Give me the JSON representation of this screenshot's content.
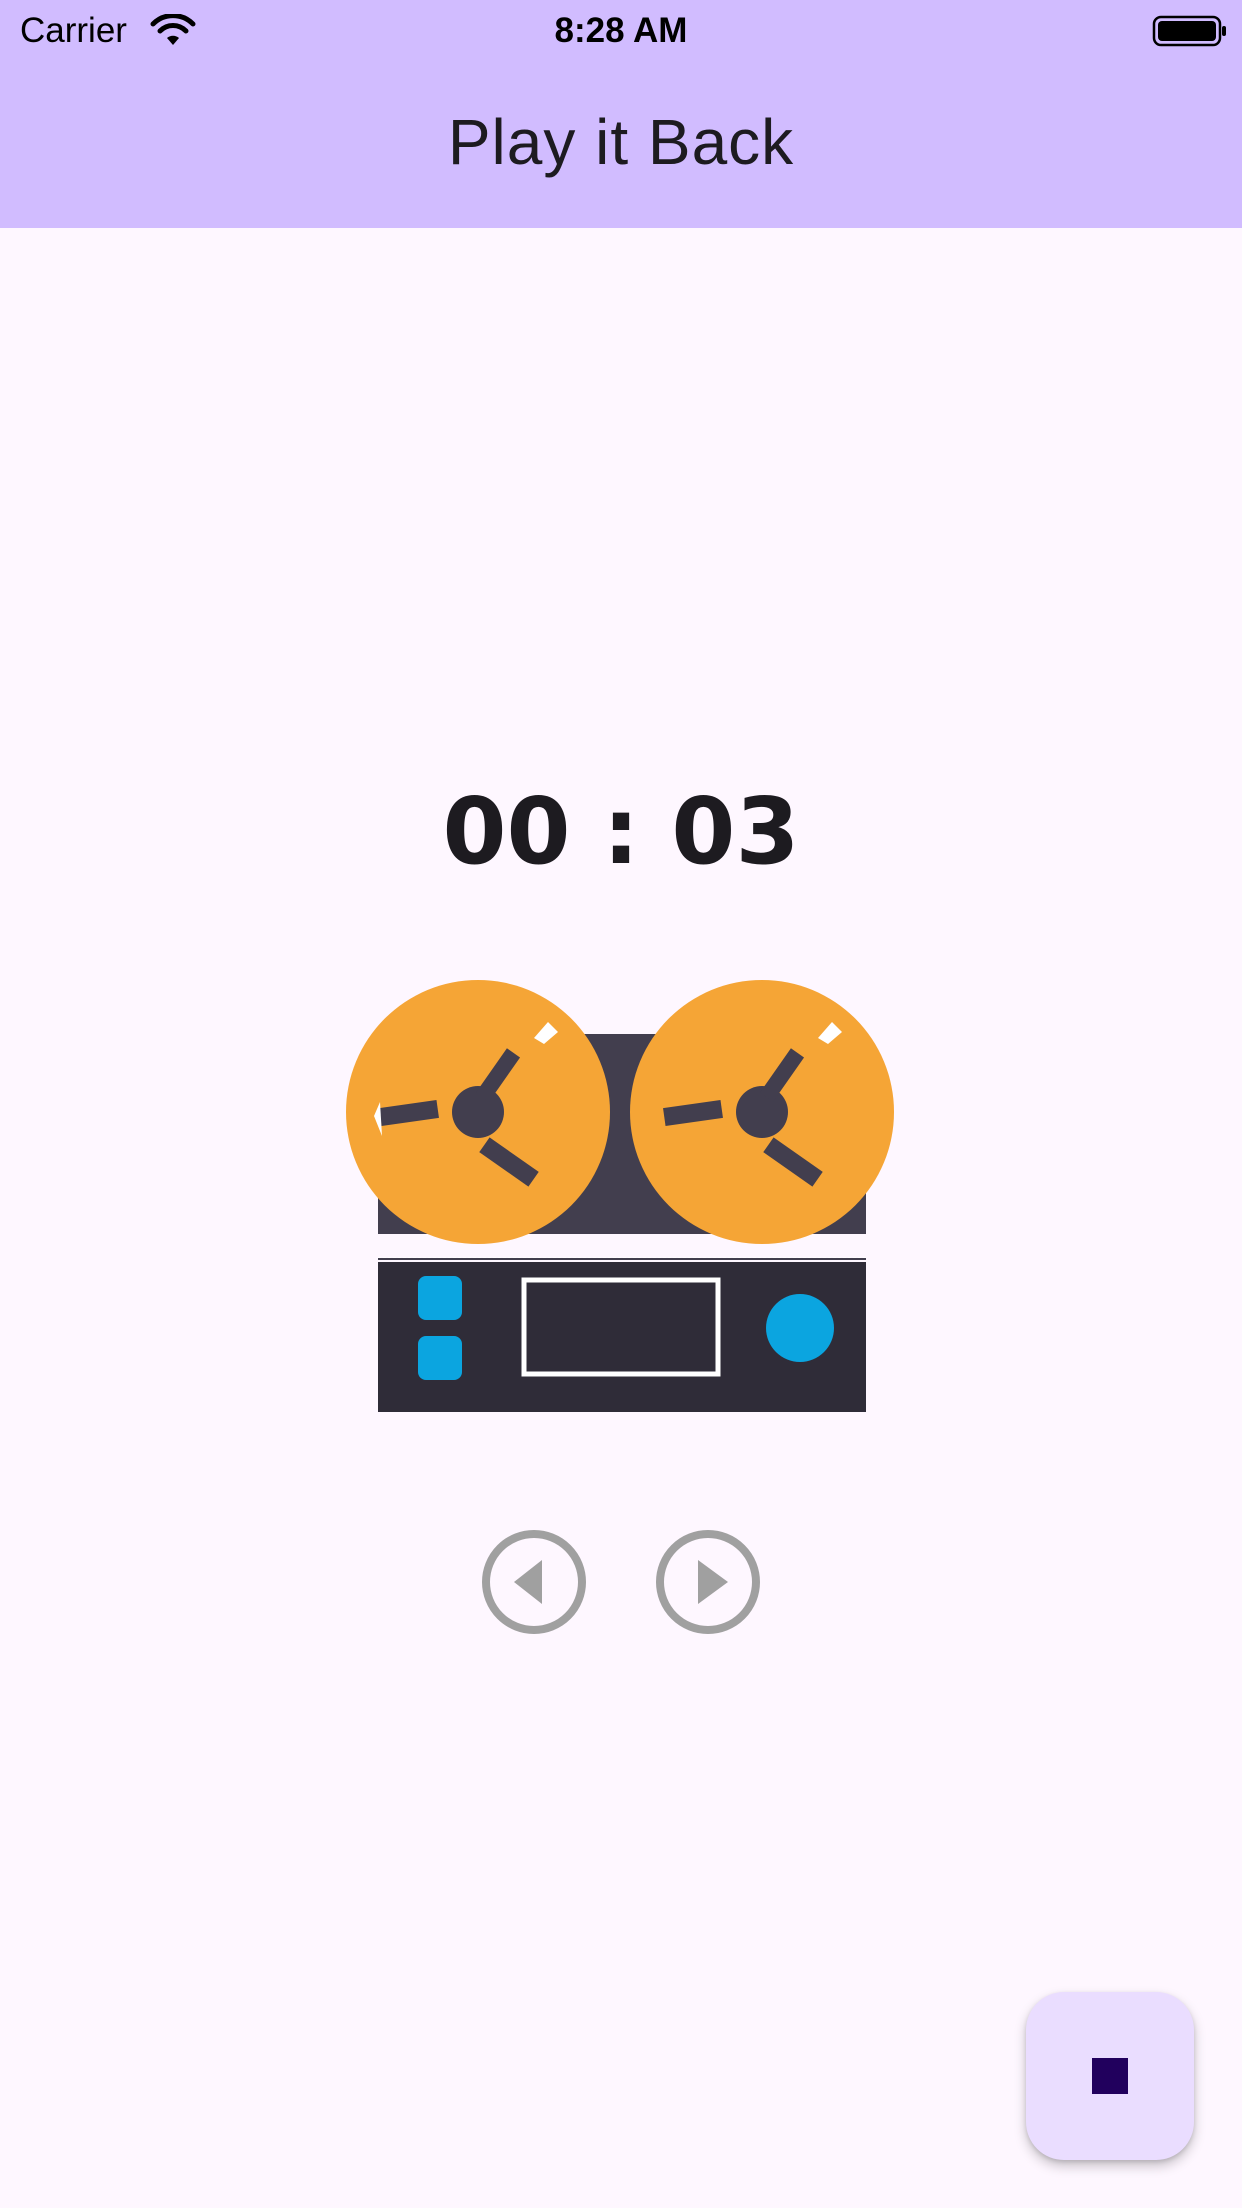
{
  "status_bar": {
    "carrier": "Carrier",
    "time": "8:28 AM",
    "wifi_icon": "wifi-icon",
    "battery_icon": "battery-full-icon"
  },
  "app_bar": {
    "title": "Play it Back",
    "background_color": "#D1BCFF"
  },
  "recorder": {
    "elapsed_time": "00 : 03",
    "illustration": "reel-to-reel-tape-recorder-icon",
    "colors": {
      "reel": "#F5A536",
      "body_top": "#423E4E",
      "body_bottom": "#2F2C38",
      "accent": "#0BA5E0"
    }
  },
  "controls": {
    "rewind_icon": "rewind-circle-icon",
    "play_icon": "play-circle-icon",
    "control_color": "#A0A0A0"
  },
  "fab": {
    "icon": "stop-icon",
    "background_color": "#EADDFF",
    "icon_color": "#21005D"
  }
}
